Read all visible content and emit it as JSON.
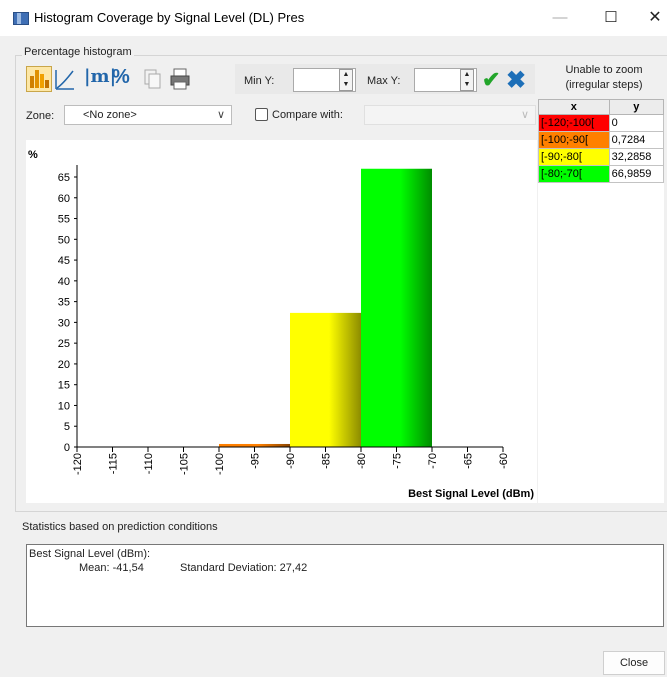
{
  "window": {
    "title": "Histogram   Coverage by Signal Level (DL) Pres"
  },
  "group": {
    "label": "Percentage histogram"
  },
  "toolbar": {
    "pct_label": "%",
    "m_label": "|m|"
  },
  "range": {
    "min_label": "Min Y:",
    "min_value": "",
    "max_label": "Max Y:",
    "max_value": ""
  },
  "zoom_note": {
    "line1": "Unable to zoom",
    "line2": "(irregular steps)"
  },
  "zone": {
    "label": "Zone:",
    "value": "<No zone>"
  },
  "compare": {
    "label": "Compare with:",
    "checked": false,
    "value": ""
  },
  "table": {
    "headers": [
      "x",
      "y"
    ],
    "rows": [
      {
        "x": "[-120;-100[",
        "y": "0",
        "color": "#ff0000"
      },
      {
        "x": "[-100;-90[",
        "y": "0,7284",
        "color": "#ff8000"
      },
      {
        "x": "[-90;-80[",
        "y": "32,2858",
        "color": "#ffff00"
      },
      {
        "x": "[-80;-70[",
        "y": "66,9859",
        "color": "#00ff00"
      }
    ]
  },
  "chart_data": {
    "type": "bar",
    "ylabel": "%",
    "xlabel": "Best Signal Level (dBm)",
    "xlim": [
      -120,
      -60
    ],
    "ylim": [
      0,
      65
    ],
    "xticks": [
      -120,
      -115,
      -110,
      -105,
      -100,
      -95,
      -90,
      -85,
      -80,
      -75,
      -70,
      -65,
      -60
    ],
    "yticks": [
      0,
      5,
      10,
      15,
      20,
      25,
      30,
      35,
      40,
      45,
      50,
      55,
      60,
      65
    ],
    "bars": [
      {
        "x0": -120,
        "x1": -100,
        "value": 0,
        "color": "#ff0000"
      },
      {
        "x0": -100,
        "x1": -90,
        "value": 0.7284,
        "color": "#ff8000"
      },
      {
        "x0": -90,
        "x1": -80,
        "value": 32.2858,
        "color": "#ffff00"
      },
      {
        "x0": -80,
        "x1": -70,
        "value": 66.9859,
        "color": "#00ff00"
      }
    ]
  },
  "stats": {
    "label": "Statistics based on prediction conditions",
    "heading": "Best Signal Level (dBm):",
    "mean": "Mean: -41,54",
    "std": "Standard Deviation: 27,42"
  },
  "buttons": {
    "close": "Close"
  }
}
